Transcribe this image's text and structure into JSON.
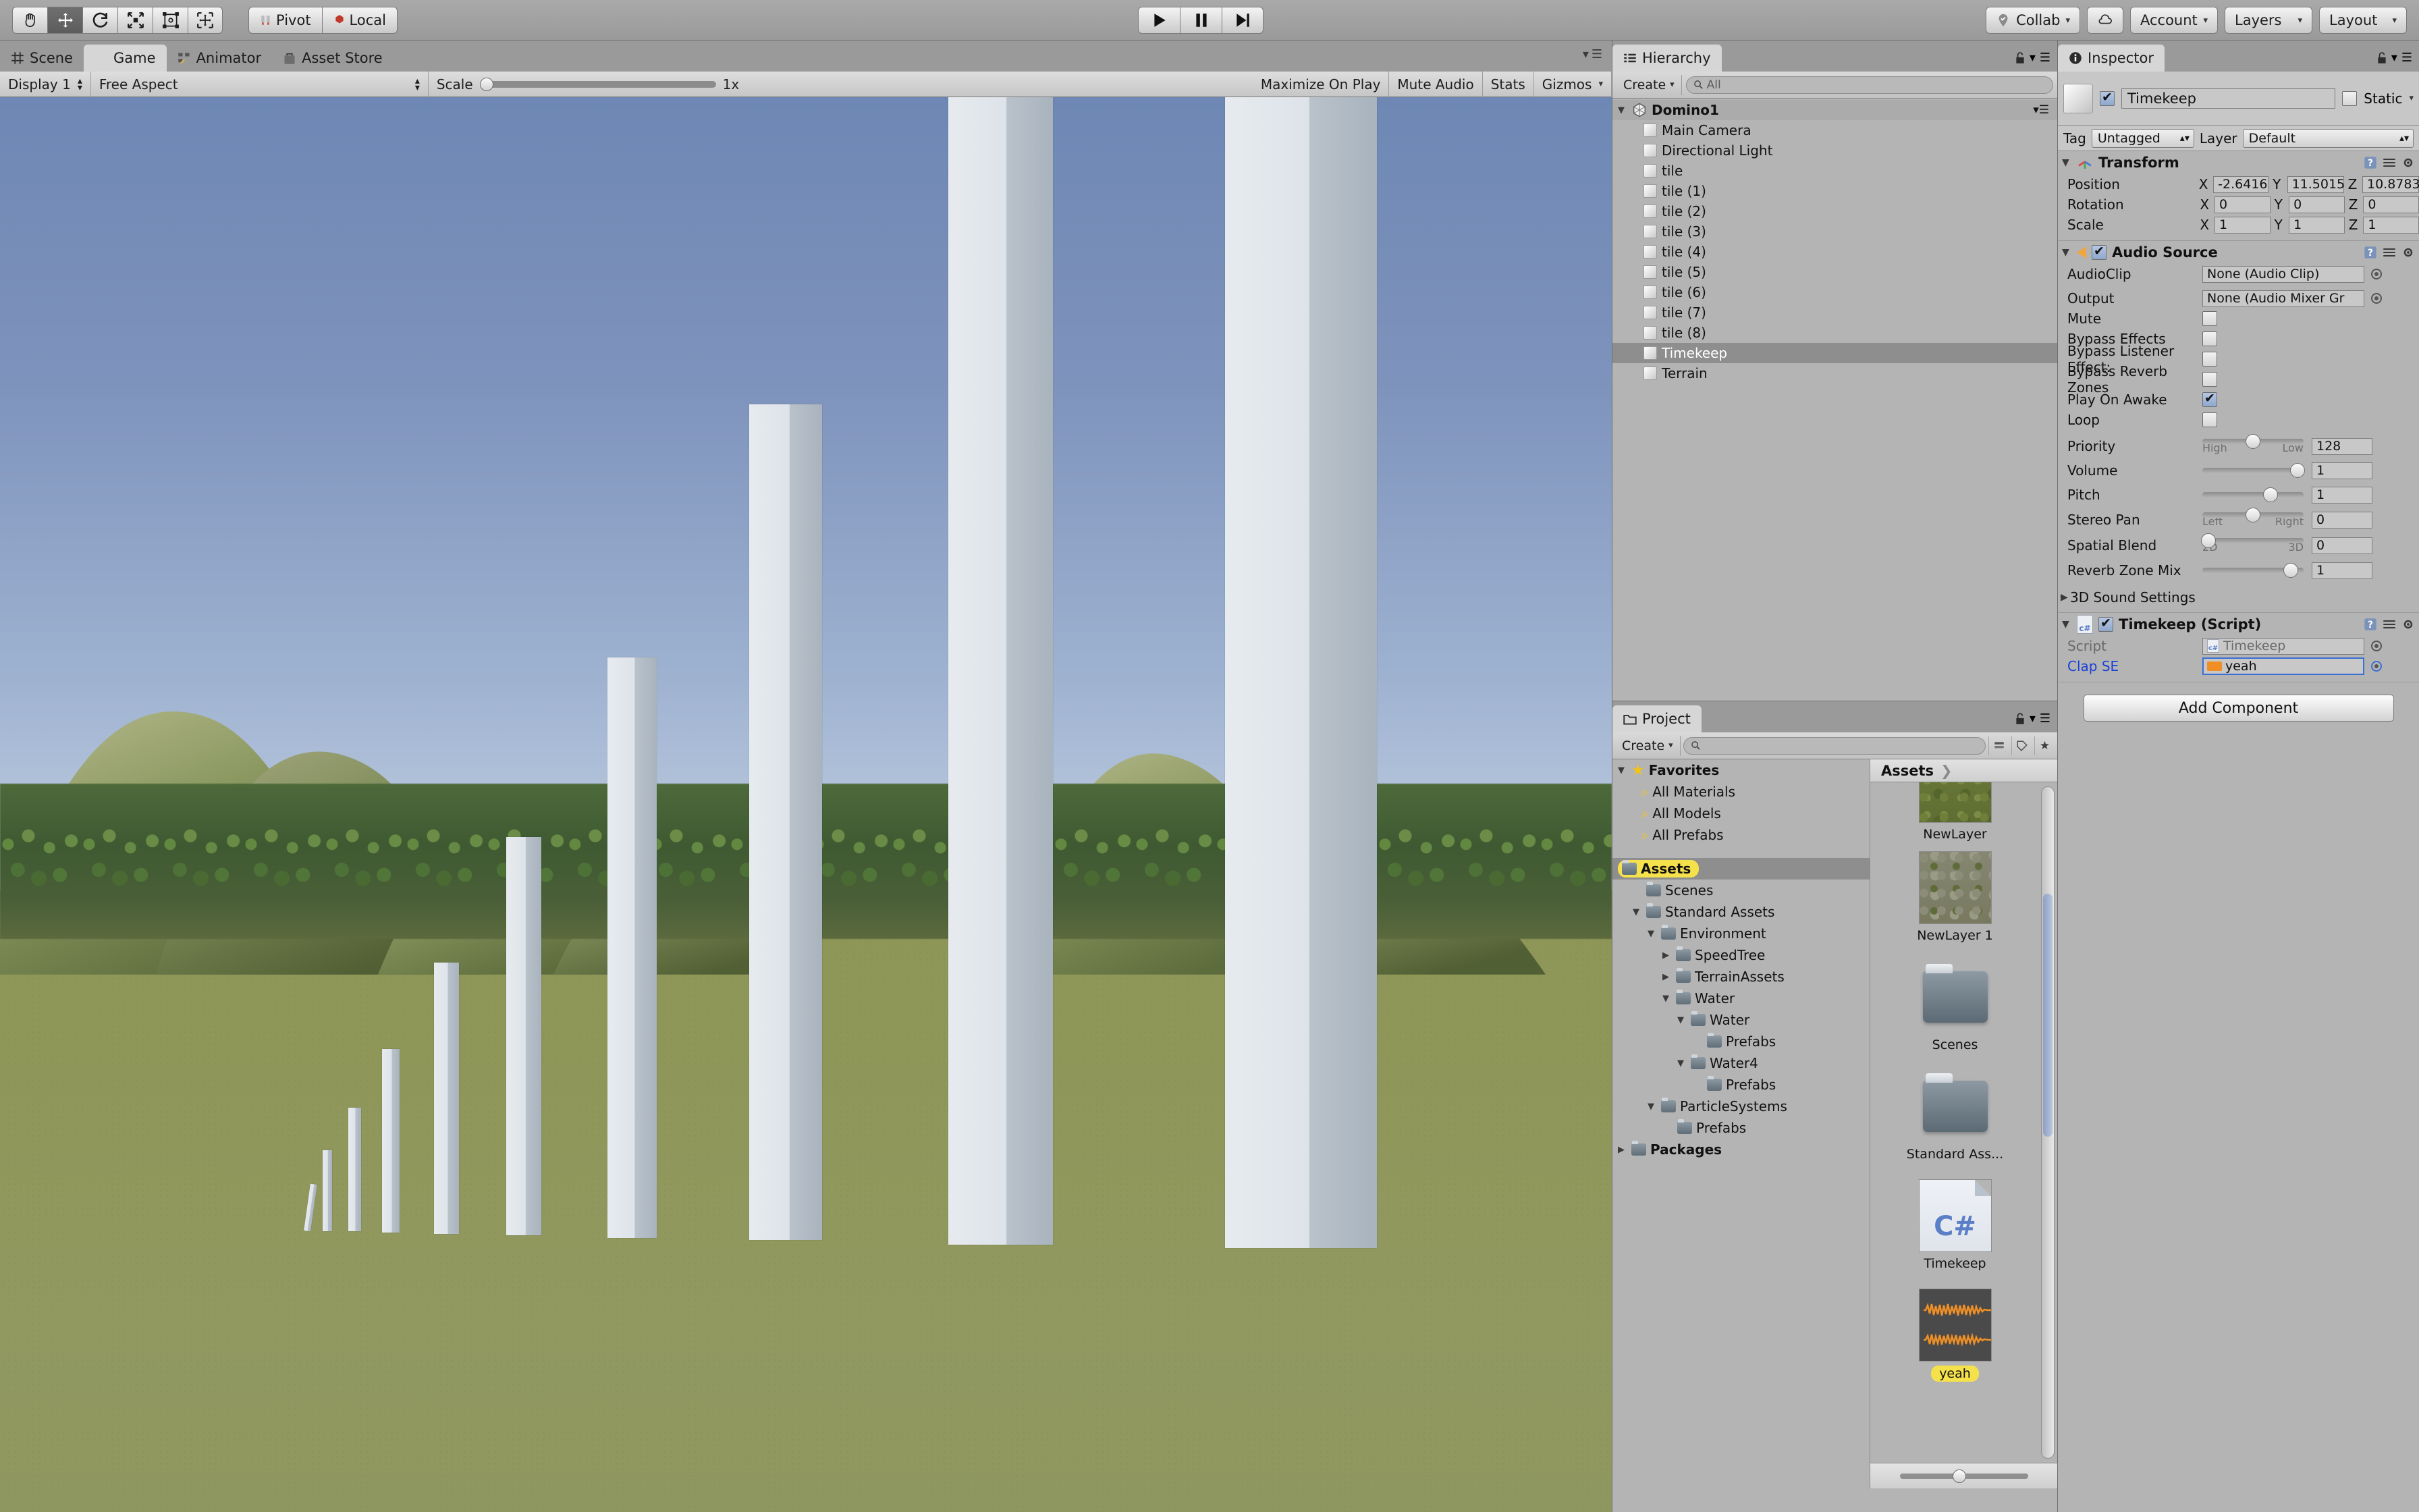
{
  "toolbar": {
    "tools": [
      {
        "name": "hand-tool",
        "glyph": "✋"
      },
      {
        "name": "move-tool",
        "glyph": "✥"
      },
      {
        "name": "rotate-tool",
        "glyph": "⟳"
      },
      {
        "name": "scale-tool",
        "glyph": "⤢"
      },
      {
        "name": "rect-tool",
        "glyph": "▣"
      },
      {
        "name": "transform-tool",
        "glyph": "✣"
      }
    ],
    "pivot_label": "Pivot",
    "local_label": "Local",
    "play_label": "▶",
    "pause_label": "❚❚",
    "step_label": "▶❙",
    "collab_label": "Collab",
    "cloud_label": "☁",
    "account_label": "Account",
    "layers_label": "Layers",
    "layout_label": "Layout"
  },
  "game_view": {
    "tabs": [
      {
        "label": "Scene",
        "icon": "grid-icon",
        "active": false
      },
      {
        "label": "Game",
        "icon": "gamepad-icon",
        "active": true
      },
      {
        "label": "Animator",
        "icon": "animator-icon",
        "active": false
      },
      {
        "label": "Asset Store",
        "icon": "store-icon",
        "active": false
      }
    ],
    "display_label": "Display 1",
    "aspect_label": "Free Aspect",
    "scale_label": "Scale",
    "scale_value": "1x",
    "maximize_label": "Maximize On Play",
    "mute_label": "Mute Audio",
    "stats_label": "Stats",
    "gizmos_label": "Gizmos",
    "scene_description": "3D terrain with trees, hills and a row of nine white domino slabs of increasing size on green grass under a blue sky"
  },
  "hierarchy": {
    "tab_label": "Hierarchy",
    "create_label": "Create",
    "search_placeholder": "All",
    "items": [
      {
        "label": "Domino1",
        "depth": 0,
        "icon": "unity-icon",
        "selected": false,
        "expanded": true
      },
      {
        "label": "Main Camera",
        "depth": 1,
        "icon": "gameobject-icon",
        "selected": false
      },
      {
        "label": "Directional Light",
        "depth": 1,
        "icon": "gameobject-icon",
        "selected": false
      },
      {
        "label": "tile",
        "depth": 1,
        "icon": "gameobject-icon",
        "selected": false
      },
      {
        "label": "tile (1)",
        "depth": 1,
        "icon": "gameobject-icon",
        "selected": false
      },
      {
        "label": "tile (2)",
        "depth": 1,
        "icon": "gameobject-icon",
        "selected": false
      },
      {
        "label": "tile (3)",
        "depth": 1,
        "icon": "gameobject-icon",
        "selected": false
      },
      {
        "label": "tile (4)",
        "depth": 1,
        "icon": "gameobject-icon",
        "selected": false
      },
      {
        "label": "tile (5)",
        "depth": 1,
        "icon": "gameobject-icon",
        "selected": false
      },
      {
        "label": "tile (6)",
        "depth": 1,
        "icon": "gameobject-icon",
        "selected": false
      },
      {
        "label": "tile (7)",
        "depth": 1,
        "icon": "gameobject-icon",
        "selected": false
      },
      {
        "label": "tile (8)",
        "depth": 1,
        "icon": "gameobject-icon",
        "selected": false
      },
      {
        "label": "Timekeep",
        "depth": 1,
        "icon": "gameobject-icon",
        "selected": true
      },
      {
        "label": "Terrain",
        "depth": 1,
        "icon": "gameobject-icon",
        "selected": false
      }
    ]
  },
  "project": {
    "tab_label": "Project",
    "create_label": "Create",
    "search_placeholder": "",
    "tree": [
      {
        "label": "Favorites",
        "depth": 0,
        "icon": "star-icon",
        "arrow": "▼",
        "bold": true
      },
      {
        "label": "All Materials",
        "depth": 1,
        "icon": "search-icon",
        "arrow": ""
      },
      {
        "label": "All Models",
        "depth": 1,
        "icon": "search-icon",
        "arrow": ""
      },
      {
        "label": "All Prefabs",
        "depth": 1,
        "icon": "search-icon",
        "arrow": ""
      },
      {
        "label": "Assets",
        "depth": 0,
        "icon": "folder-icon",
        "arrow": "",
        "selected": true,
        "pill": true
      },
      {
        "label": "Scenes",
        "depth": 1,
        "icon": "folder-icon",
        "arrow": ""
      },
      {
        "label": "Standard Assets",
        "depth": 1,
        "icon": "folder-icon",
        "arrow": "▼"
      },
      {
        "label": "Environment",
        "depth": 2,
        "icon": "folder-icon",
        "arrow": "▼"
      },
      {
        "label": "SpeedTree",
        "depth": 3,
        "icon": "folder-icon",
        "arrow": "▶"
      },
      {
        "label": "TerrainAssets",
        "depth": 3,
        "icon": "folder-icon",
        "arrow": "▶"
      },
      {
        "label": "Water",
        "depth": 3,
        "icon": "folder-icon",
        "arrow": "▼"
      },
      {
        "label": "Water",
        "depth": 4,
        "icon": "folder-icon",
        "arrow": "▼"
      },
      {
        "label": "Prefabs",
        "depth": 5,
        "icon": "folder-icon",
        "arrow": ""
      },
      {
        "label": "Water4",
        "depth": 4,
        "icon": "folder-icon",
        "arrow": "▼"
      },
      {
        "label": "Prefabs",
        "depth": 5,
        "icon": "folder-icon",
        "arrow": ""
      },
      {
        "label": "ParticleSystems",
        "depth": 2,
        "icon": "folder-icon",
        "arrow": "▼"
      },
      {
        "label": "Prefabs",
        "depth": 3,
        "icon": "folder-icon",
        "arrow": ""
      },
      {
        "label": "Packages",
        "depth": 0,
        "icon": "folder-icon",
        "arrow": "▶",
        "bold": true
      }
    ],
    "breadcrumb": "Assets",
    "breadcrumb_sep": "❯",
    "assets": [
      {
        "label": "NewLayer",
        "kind": "texture-grass",
        "selected": false
      },
      {
        "label": "NewLayer 1",
        "kind": "texture-dirt",
        "selected": false
      },
      {
        "label": "Scenes",
        "kind": "folder",
        "selected": false
      },
      {
        "label": "Standard Ass...",
        "kind": "folder",
        "selected": false
      },
      {
        "label": "Timekeep",
        "kind": "csharp",
        "selected": false
      },
      {
        "label": "yeah",
        "kind": "audio",
        "selected": true
      }
    ]
  },
  "inspector": {
    "tab_label": "Inspector",
    "object_name": "Timekeep",
    "object_enabled": true,
    "static_label": "Static",
    "tag_label": "Tag",
    "tag_value": "Untagged",
    "layer_label": "Layer",
    "layer_value": "Default",
    "transform": {
      "title": "Transform",
      "rows": [
        {
          "label": "Position",
          "x": "-2.6416",
          "y": "11.5015",
          "z": "10.8783"
        },
        {
          "label": "Rotation",
          "x": "0",
          "y": "0",
          "z": "0"
        },
        {
          "label": "Scale",
          "x": "1",
          "y": "1",
          "z": "1"
        }
      ],
      "axis_labels": [
        "X",
        "Y",
        "Z"
      ]
    },
    "audio_source": {
      "title": "Audio Source",
      "enabled": true,
      "audioclip_label": "AudioClip",
      "audioclip_value": "None (Audio Clip)",
      "output_label": "Output",
      "output_value": "None (Audio Mixer Gr",
      "mute_label": "Mute",
      "mute_checked": false,
      "bypass_effects_label": "Bypass Effects",
      "bypass_effects_checked": false,
      "bypass_listener_label": "Bypass Listener Effect:",
      "bypass_listener_checked": false,
      "bypass_reverb_label": "Bypass Reverb Zones",
      "bypass_reverb_checked": false,
      "play_on_awake_label": "Play On Awake",
      "play_on_awake_checked": true,
      "loop_label": "Loop",
      "loop_checked": false,
      "priority_label": "Priority",
      "priority_value": "128",
      "priority_min_label": "High",
      "priority_max_label": "Low",
      "volume_label": "Volume",
      "volume_value": "1",
      "pitch_label": "Pitch",
      "pitch_value": "1",
      "stereo_pan_label": "Stereo Pan",
      "stereo_pan_value": "0",
      "stereo_min_label": "Left",
      "stereo_max_label": "Right",
      "spatial_blend_label": "Spatial Blend",
      "spatial_blend_value": "0",
      "spatial_min_label": "2D",
      "spatial_max_label": "3D",
      "reverb_zone_label": "Reverb Zone Mix",
      "reverb_zone_value": "1",
      "sound_settings_label": "3D Sound Settings"
    },
    "script_component": {
      "title": "Timekeep (Script)",
      "enabled": true,
      "script_label": "Script",
      "script_value": "Timekeep",
      "clap_label": "Clap SE",
      "clap_value": "yeah"
    },
    "add_component_label": "Add Component"
  },
  "colors": {
    "chrome": "#a0a0a0",
    "panel": "#b4b4b4",
    "selection": "#8e8e8e",
    "accent_yellow": "#f5e14b",
    "accent_blue": "#3b6fd4",
    "link_blue": "#1a3fd8",
    "audio_orange": "#ef8f26"
  }
}
